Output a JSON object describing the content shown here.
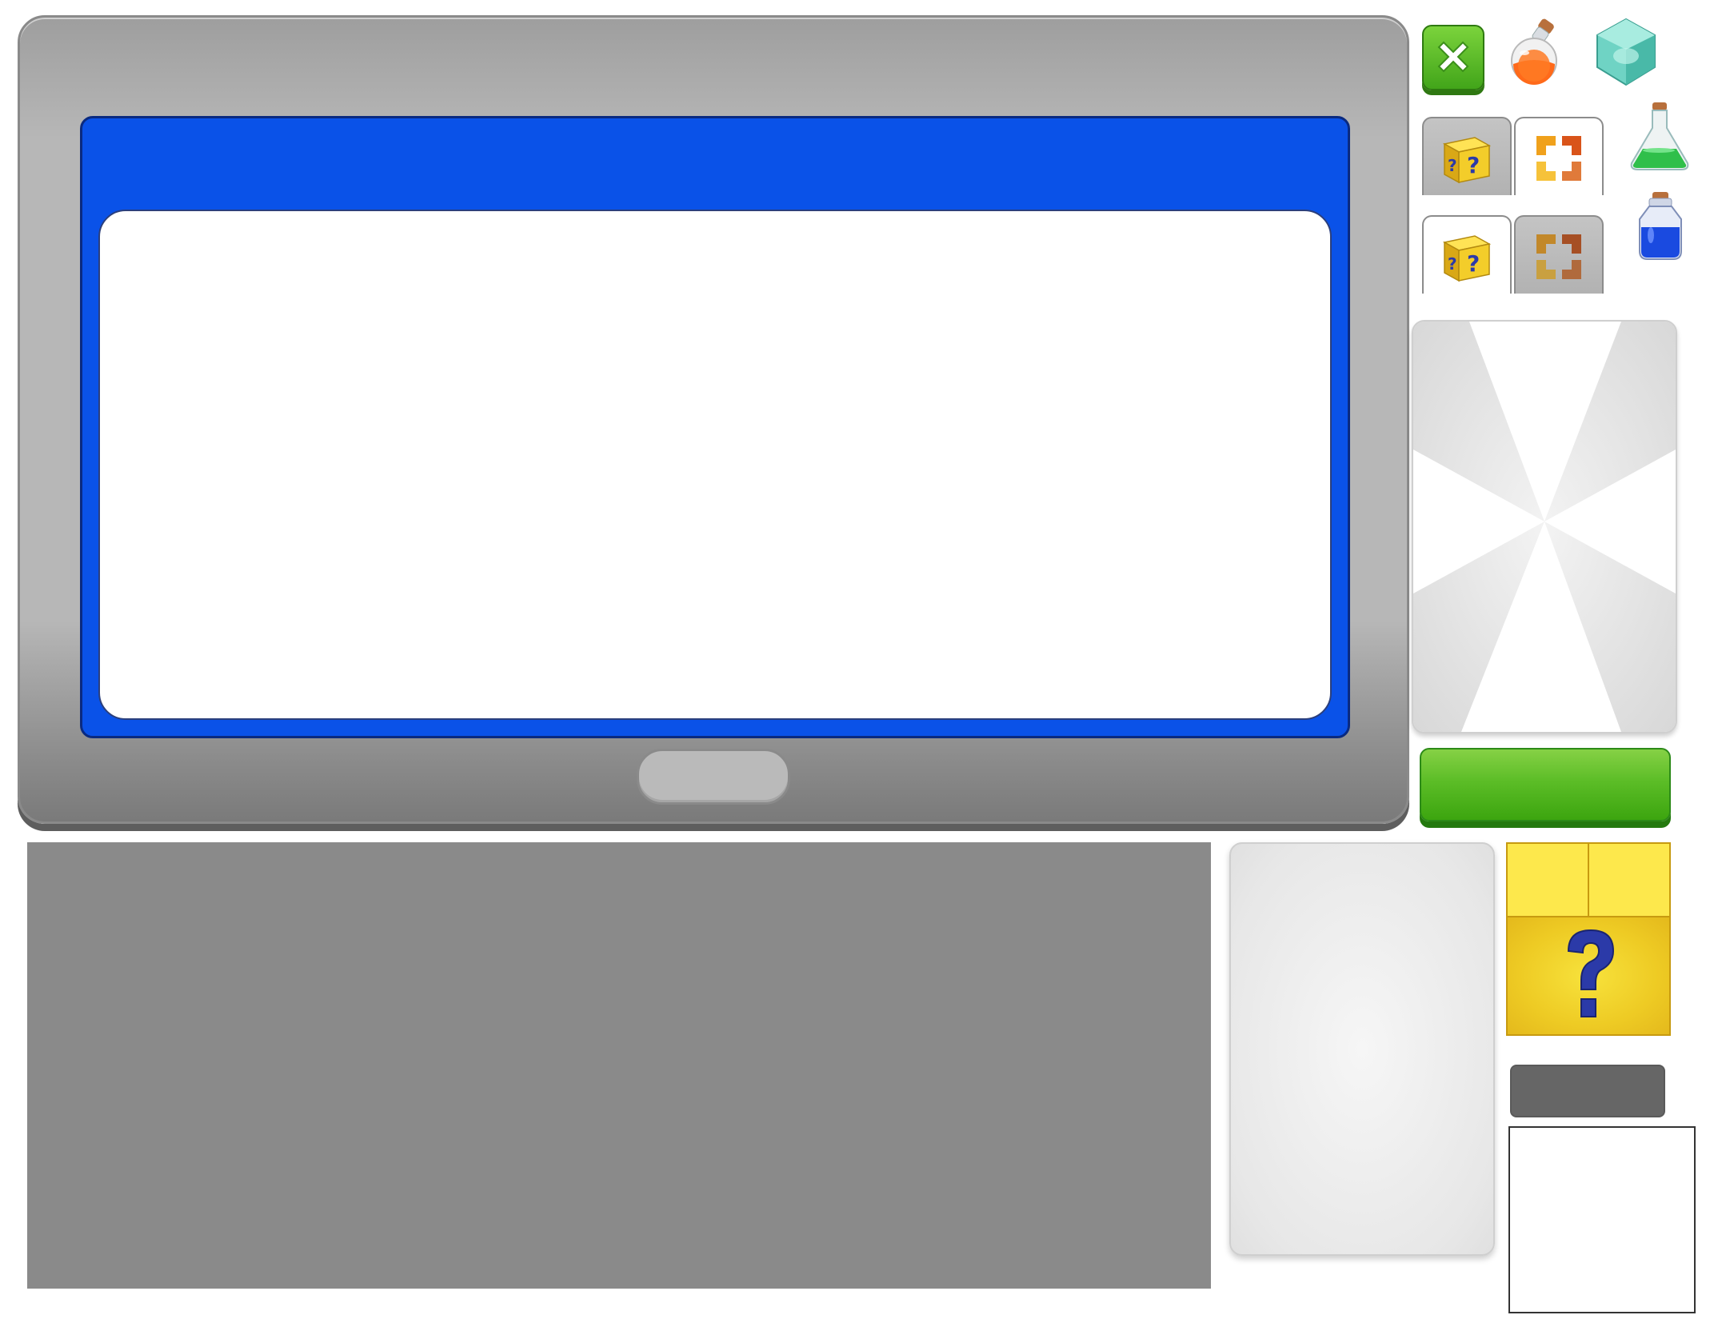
{
  "dialog": {
    "title": "",
    "body": "",
    "ok_label": ""
  },
  "tabs": [
    {
      "icon": "mystery-block-icon",
      "state": "inactive"
    },
    {
      "icon": "frame-puzzle-icon",
      "state": "active"
    },
    {
      "icon": "mystery-block-icon",
      "state": "active"
    },
    {
      "icon": "frame-puzzle-icon",
      "state": "inactive"
    }
  ],
  "icons": {
    "close": "close-icon",
    "orange_potion": "orange-potion-icon",
    "gem": "teal-gem-icon",
    "green_flask": "green-flask-icon",
    "blue_potion": "blue-potion-icon",
    "mystery_block": "mystery-block-icon"
  },
  "buttons": {
    "green_label": ""
  },
  "colors": {
    "dialog_accent": "#0a52e8",
    "panel_gray": "#b7b7b7",
    "button_green": "#5cbd27",
    "block_yellow": "#f3d833",
    "question_mark_blue": "#2b3aa8"
  }
}
